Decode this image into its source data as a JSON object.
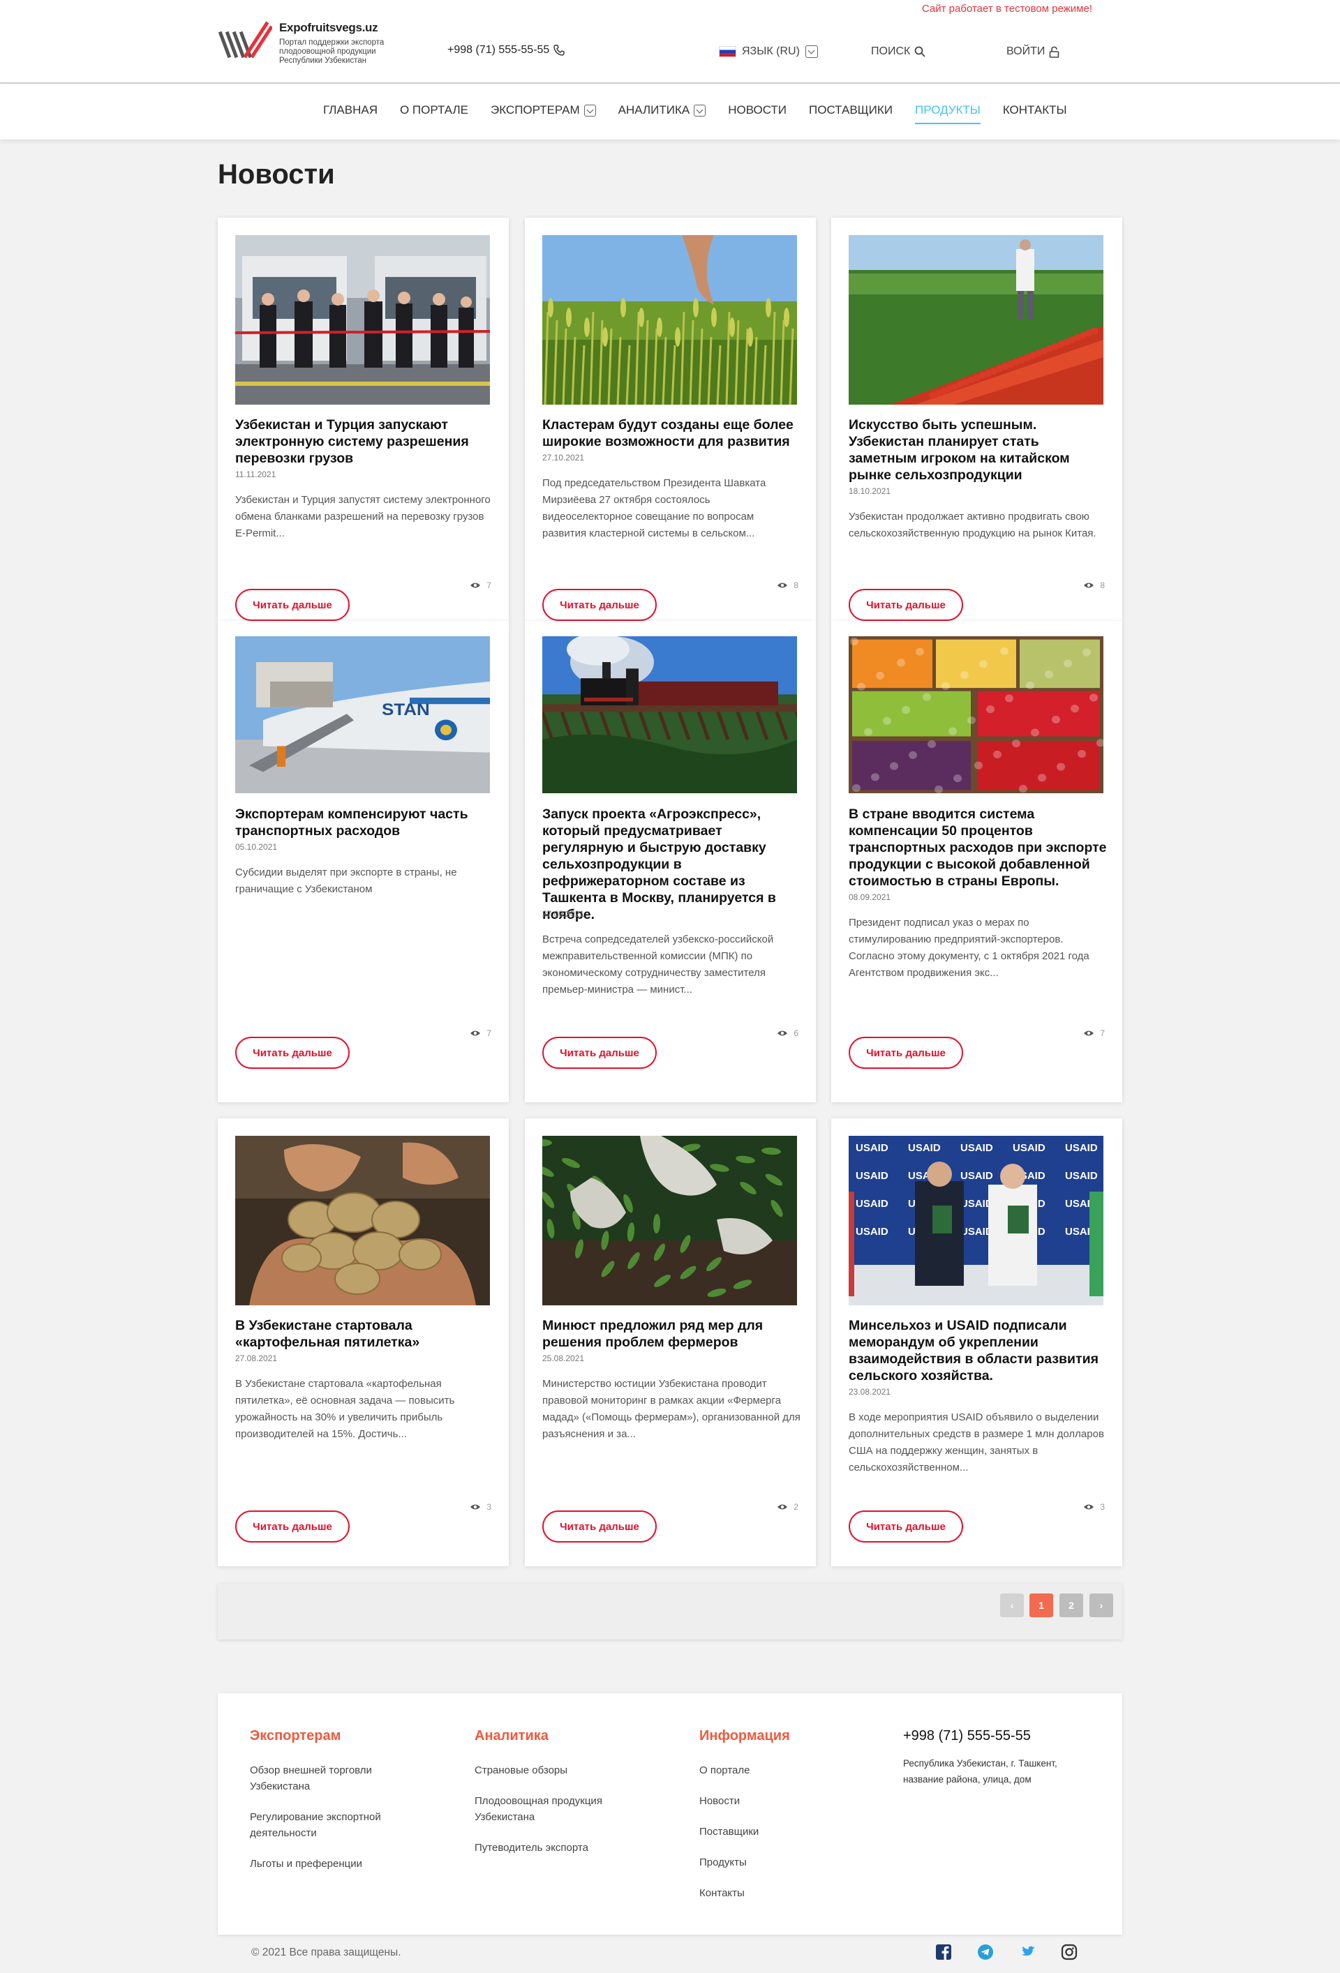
{
  "header": {
    "test_notice": "Сайт работает в тестовом режиме!",
    "logo_title": "Expofruitsvegs.uz",
    "logo_subtitle": "Портал поддержки экспорта плодоовощной продукции Республики Узбекистан",
    "phone": "+998 (71) 555-55-55",
    "language": "ЯЗЫК (RU)",
    "search": "ПОИСК",
    "login": "ВОЙТИ"
  },
  "nav": {
    "items": [
      {
        "label": "ГЛАВНАЯ"
      },
      {
        "label": "О ПОРТАЛЕ"
      },
      {
        "label": "ЭКСПОРТЕРАМ"
      },
      {
        "label": "АНАЛИТИКА"
      },
      {
        "label": "НОВОСТИ"
      },
      {
        "label": "ПОСТАВЩИКИ"
      },
      {
        "label": "ПРОДУКТЫ"
      },
      {
        "label": "КОНТАКТЫ"
      }
    ],
    "active": "ПРОДУКТЫ"
  },
  "page_title": "Новости",
  "read_more": "Читать дальше",
  "news": [
    {
      "title": "Узбекистан и Турция запускают электронную систему разрешения перевозки грузов",
      "date": "11.11.2021",
      "desc": "Узбекистан и Турция запустят систему электронного обмена бланками разрешений на перевозку грузов E-Permit...",
      "views": "7",
      "image": "trucks-ribbon-ceremony"
    },
    {
      "title": "Кластерам будут созданы еще более широкие возможности для развития",
      "date": "27.10.2021",
      "desc": "Под председательством Президента Шавката Мирзиёева 27 октября состоялось видеоселекторное совещание по вопросам развития кластерной системы в сельском...",
      "views": "8",
      "image": "wheat-field-hand"
    },
    {
      "title": "Искусство быть успешным. Узбекистан планирует стать заметным игроком на китайском рынке сельхозпродукции",
      "date": "18.10.2021",
      "desc": "Узбекистан продолжает активно продвигать свою сельскохозяйственную продукцию на рынок Китая.",
      "views": "8",
      "image": "tomato-harvest-field"
    },
    {
      "title": "Экспортерам компенсируют часть транспортных расходов",
      "date": "05.10.2021",
      "desc": "Субсидии выделят при экспорте в страны, не граничащие с Узбекистаном",
      "views": "7",
      "image": "cargo-airplane-loading"
    },
    {
      "title": "Запуск проекта «Агроэкспресс», который предусматривает регулярную и быструю доставку сельхозпродукции в рефрижераторном составе из Ташкента в Москву, планируется в ноябре.",
      "date": "27.09.2021",
      "desc": "Встреча сопредседателей узбекско-российской межправительственной комиссии (МПК) по экономическому сотрудничеству заместителя премьер-министра — минист...",
      "views": "6",
      "image": "steam-train-bridge"
    },
    {
      "title": "В стране вводится система компенсации 50 процентов транспортных расходов при экспорте продукции с высокой добавленной стоимостью в страны Европы.",
      "date": "08.09.2021",
      "desc": "Президент подписал указ о мерах по стимулированию предприятий-экспортеров. Согласно этому документу, с 1 октября 2021 года Агентством продвижения экс...",
      "views": "7",
      "image": "fruit-market-stall"
    },
    {
      "title": "В Узбекистане стартовала «картофельная пятилетка»",
      "date": "27.08.2021",
      "desc": "В Узбекистане стартовала «картофельная пятилетка», её основная задача — повысить урожайность на 30% и увеличить прибыль производителей на 15%. Достичь...",
      "views": "3",
      "image": "potatoes-in-hands"
    },
    {
      "title": "Минюст предложил ряд мер для решения проблем фермеров",
      "date": "25.08.2021",
      "desc": "Министерство юстиции Узбекистана проводит правовой мониторинг в рамках акции «Фермерга мадад» («Помощь фермерам»), организованной для разъяснения и за...",
      "views": "2",
      "image": "gloved-hands-plants"
    },
    {
      "title": "Минсельхоз и USAID подписали меморандум об укреплении взаимодействия в области развития сельского хозяйства.",
      "date": "23.08.2021",
      "desc": "В ходе мероприятия USAID объявило о выделении дополнительных средств в размере 1 млн долларов США на поддержку женщин, занятых в сельскохозяйственном...",
      "views": "3",
      "image": "usaid-memorandum-signing"
    }
  ],
  "usaid_banner": "USAID",
  "pagination": {
    "prev": "‹",
    "pages": [
      "1",
      "2"
    ],
    "current": "1",
    "next": "›"
  },
  "footer": {
    "col1": {
      "title": "Экспортерам",
      "links": [
        "Обзор внешней торговли Узбекистана",
        "Регулирование экспортной деятельности",
        "Льготы и преференции"
      ]
    },
    "col2": {
      "title": "Аналитика",
      "links": [
        "Страновые обзоры",
        "Плодоовощная продукция Узбекистана",
        "Путеводитель экспорта"
      ]
    },
    "col3": {
      "title": "Информация",
      "links": [
        "О портале",
        "Новости",
        "Поставщики",
        "Продукты",
        "Контакты"
      ]
    },
    "phone": "+998 (71) 555-55-55",
    "address": "Республика Узбекистан, г. Ташкент, название района, улица, дом",
    "copyright": "© 2021 Все права защищены.",
    "socials": [
      "facebook-icon",
      "telegram-icon",
      "twitter-icon",
      "instagram-icon"
    ]
  },
  "colors": {
    "accent_red": "#e3102c",
    "nav_active": "#46c5ec",
    "footer_heading": "#ef5a3c"
  }
}
